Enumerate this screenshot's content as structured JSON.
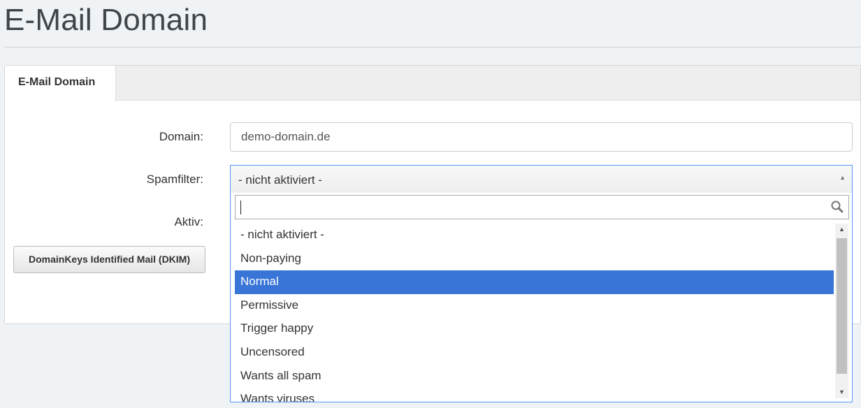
{
  "page": {
    "title": "E-Mail Domain"
  },
  "tabs": [
    {
      "label": "E-Mail Domain",
      "active": true
    }
  ],
  "form": {
    "domain_label": "Domain:",
    "domain_value": "demo-domain.de",
    "spamfilter_label": "Spamfilter:",
    "spamfilter_value": "- nicht aktiviert -",
    "aktiv_label": "Aktiv:",
    "dkim_button": "DomainKeys Identified Mail (DKIM)"
  },
  "dropdown": {
    "search_value": "",
    "options": [
      "- nicht aktiviert -",
      "Non-paying",
      "Normal",
      "Permissive",
      "Trigger happy",
      "Uncensored",
      "Wants all spam",
      "Wants viruses"
    ],
    "highlighted": "Normal"
  },
  "icons": {
    "search": "search-icon",
    "select_arrow": "caret-up-icon",
    "scroll_up": "scroll-up-icon",
    "scroll_down": "scroll-down-icon"
  },
  "colors": {
    "highlight": "#3875d7",
    "focus_border": "#5897fb",
    "page_background": "#f0f3f5"
  }
}
